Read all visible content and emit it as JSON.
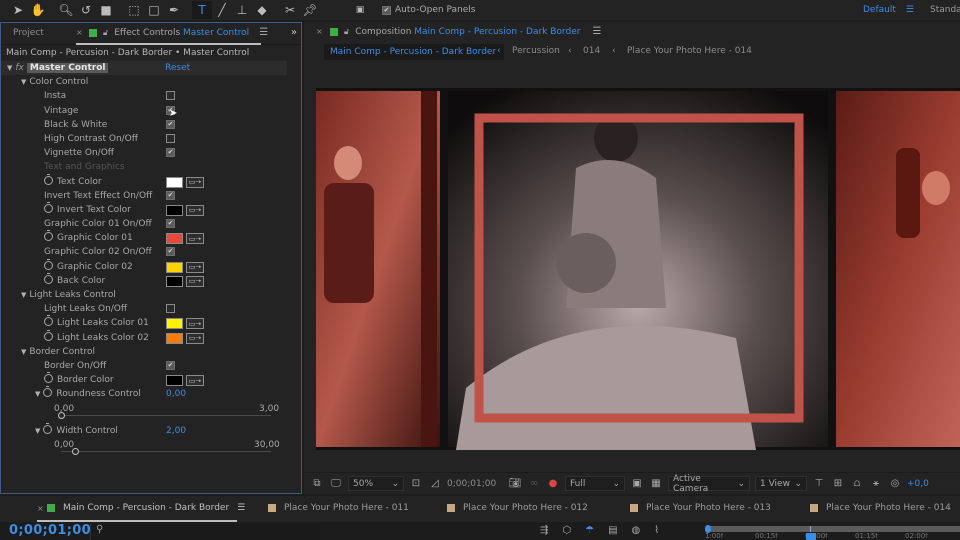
{
  "toolbar": {
    "tools": [
      {
        "name": "selection-tool",
        "glyph": "➤"
      },
      {
        "name": "hand-tool",
        "glyph": "✋"
      },
      {
        "name": "zoom-tool",
        "glyph": "🔍︎"
      },
      {
        "name": "rotate-tool",
        "glyph": "↺"
      },
      {
        "name": "camera-tool",
        "glyph": "■"
      },
      {
        "name": "pan-behind-tool",
        "glyph": "⬚"
      },
      {
        "name": "rectangle-tool",
        "glyph": "□"
      },
      {
        "name": "pen-tool",
        "glyph": "✒"
      },
      {
        "name": "type-tool",
        "glyph": "T"
      },
      {
        "name": "brush-tool",
        "glyph": "╱"
      },
      {
        "name": "clone-stamp-tool",
        "glyph": "⊥"
      },
      {
        "name": "eraser-tool",
        "glyph": "◆"
      },
      {
        "name": "roto-brush-tool",
        "glyph": "✂"
      },
      {
        "name": "puppet-pin-tool",
        "glyph": "📌︎"
      }
    ],
    "auto_open_label": "Auto-Open Panels",
    "auto_open_checked": true,
    "workspace_default": "Default",
    "workspace_standard": "Standa"
  },
  "left_panel": {
    "project_tab": "Project",
    "effect_controls_label": "Effect Controls",
    "effect_controls_layer": "Master Control",
    "breadcrumb": "Main Comp - Percusion - Dark Border • Master Control",
    "effect_name": "Master Control",
    "reset_label": "Reset",
    "groups": {
      "color_control": "Color Control",
      "light_leaks": "Light Leaks Control",
      "border": "Border Control"
    },
    "props": {
      "insta": {
        "label": "Insta",
        "checked": false
      },
      "vintage": {
        "label": "Vintage",
        "checked": true
      },
      "bw": {
        "label": "Black & White",
        "checked": true
      },
      "high_contrast": {
        "label": "High Contrast On/Off",
        "checked": false
      },
      "vignette": {
        "label": "Vignette On/Off",
        "checked": true
      },
      "text_graphics": {
        "label": "Text and Graphics"
      },
      "text_color": {
        "label": "Text Color",
        "color": "#ffffff"
      },
      "invert_text_effect": {
        "label": "Invert Text Effect On/Off",
        "checked": true
      },
      "invert_text_color": {
        "label": "Invert Text Color",
        "color": "#000000"
      },
      "graphic01_onoff": {
        "label": "Graphic Color 01 On/Off",
        "checked": true
      },
      "graphic01_color": {
        "label": "Graphic Color 01",
        "color": "#e8483e"
      },
      "graphic02_onoff": {
        "label": "Graphic Color 02 On/Off",
        "checked": true
      },
      "graphic02_color": {
        "label": "Graphic Color 02",
        "color": "#ffd200"
      },
      "back_color": {
        "label": "Back Color",
        "color": "#000000"
      },
      "light_leaks_onoff": {
        "label": "Light Leaks On/Off",
        "checked": false
      },
      "ll_color01": {
        "label": "Light Leaks Color 01",
        "color": "#fff200"
      },
      "ll_color02": {
        "label": "Light Leaks Color 02",
        "color": "#ff7a00"
      },
      "border_onoff": {
        "label": "Border On/Off",
        "checked": true
      },
      "border_color": {
        "label": "Border Color",
        "color": "#000000"
      },
      "roundness": {
        "label": "Roundness Control",
        "value": "0,00",
        "min": "0,00",
        "max": "3,00",
        "fraction": 0.0
      },
      "width": {
        "label": "Width Control",
        "value": "2,00",
        "min": "0,00",
        "max": "30,00",
        "fraction": 0.0667
      }
    }
  },
  "composition": {
    "tab_label": "Composition",
    "tab_comp": "Main Comp - Percusion - Dark Border",
    "crumbs": [
      "Main Comp - Percusion - Dark Border",
      "Percussion",
      "014",
      "Place Your Photo Here - 014"
    ],
    "viewer": {
      "zoom": "50%",
      "timecode": "0;00;01;00",
      "resolution": "Full",
      "camera": "Active Camera",
      "views": "1 View",
      "exposure": "+0,0"
    }
  },
  "timeline": {
    "timecode": "0;00;01;00",
    "tabs": [
      {
        "label": "Main Comp - Percusion - Dark Border",
        "color": "#3fae4a",
        "active": true
      },
      {
        "label": "Place Your Photo Here - 011",
        "color": "#c8a882"
      },
      {
        "label": "Place Your Photo Here - 012",
        "color": "#c8a882"
      },
      {
        "label": "Place Your Photo Here - 013",
        "color": "#c8a882"
      },
      {
        "label": "Place Your Photo Here - 014",
        "color": "#c8a882"
      }
    ],
    "ruler_labels": [
      "1:00f",
      "00:15f",
      "01:00f",
      "01:15f",
      "02:00f"
    ]
  }
}
